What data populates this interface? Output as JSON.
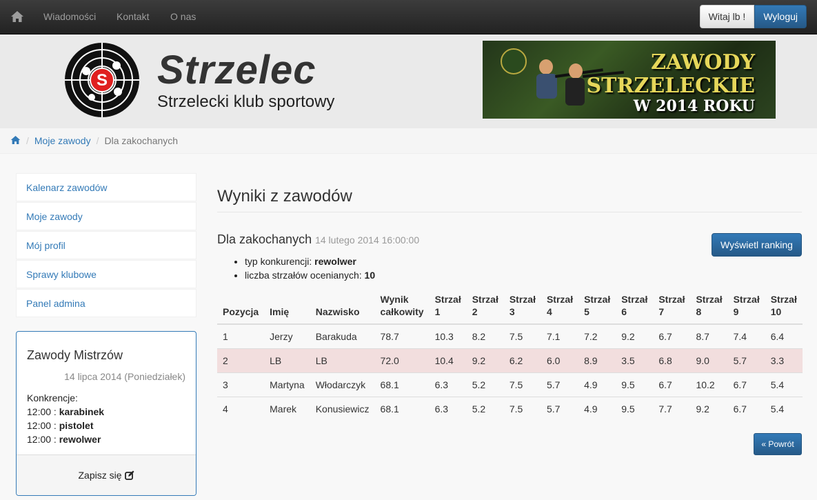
{
  "nav": {
    "links": [
      "Wiadomości",
      "Kontakt",
      "O nas"
    ],
    "greeting": "Witaj lb !",
    "logout": "Wyloguj"
  },
  "header": {
    "brand": "Strzelec",
    "subtitle": "Strzelecki klub sportowy",
    "logo_letter": "S",
    "banner_lines": [
      "ZAWODY",
      "STRZELECKIE",
      "W 2014 ROKU"
    ]
  },
  "breadcrumb": {
    "link": "Moje zawody",
    "active": "Dla zakochanych"
  },
  "sidebar": {
    "items": [
      "Kalenarz zawodów",
      "Moje zawody",
      "Mój profil",
      "Sprawy klubowe",
      "Panel admina"
    ]
  },
  "event_panel": {
    "title": "Zawody Mistrzów",
    "date": "14 lipca 2014 (Poniedziałek)",
    "competitions_label": "Konkrencje:",
    "competitions": [
      {
        "time": "12:00",
        "name": "karabinek"
      },
      {
        "time": "12:00",
        "name": "pistolet"
      },
      {
        "time": "12:00",
        "name": "rewolwer"
      }
    ],
    "signup": "Zapisz się"
  },
  "main": {
    "title": "Wyniki z zawodów",
    "competition_name": "Dla zakochanych",
    "competition_date": "14 lutego 2014 16:00:00",
    "ranking_button": "Wyświetl ranking",
    "info": [
      {
        "label": "typ konkurencji: ",
        "value": "rewolwer"
      },
      {
        "label": "liczba strzałów ocenianych: ",
        "value": "10"
      }
    ],
    "back_button": "« Powrót"
  },
  "table": {
    "headers": [
      "Pozycja",
      "Imię",
      "Nazwisko",
      "Wynik całkowity",
      "Strzał 1",
      "Strzał 2",
      "Strzał 3",
      "Strzał 4",
      "Strzał 5",
      "Strzał 6",
      "Strzał 7",
      "Strzał 8",
      "Strzał 9",
      "Strzał 10"
    ],
    "rows": [
      {
        "cells": [
          "1",
          "Jerzy",
          "Barakuda",
          "78.7",
          "10.3",
          "8.2",
          "7.5",
          "7.1",
          "7.2",
          "9.2",
          "6.7",
          "8.7",
          "7.4",
          "6.4"
        ],
        "highlight": false
      },
      {
        "cells": [
          "2",
          "LB",
          "LB",
          "72.0",
          "10.4",
          "9.2",
          "6.2",
          "6.0",
          "8.9",
          "3.5",
          "6.8",
          "9.0",
          "5.7",
          "3.3"
        ],
        "highlight": true
      },
      {
        "cells": [
          "3",
          "Martyna",
          "Włodarczyk",
          "68.1",
          "6.3",
          "5.2",
          "7.5",
          "5.7",
          "4.9",
          "9.5",
          "6.7",
          "10.2",
          "6.7",
          "5.4"
        ],
        "highlight": false
      },
      {
        "cells": [
          "4",
          "Marek",
          "Konusiewicz",
          "68.1",
          "6.3",
          "5.2",
          "7.5",
          "5.7",
          "4.9",
          "9.5",
          "7.7",
          "9.2",
          "6.7",
          "5.4"
        ],
        "highlight": false
      }
    ]
  },
  "colors": {
    "link": "#337ab7",
    "primary": "#337ab7",
    "highlight_row": "#f2dede"
  }
}
